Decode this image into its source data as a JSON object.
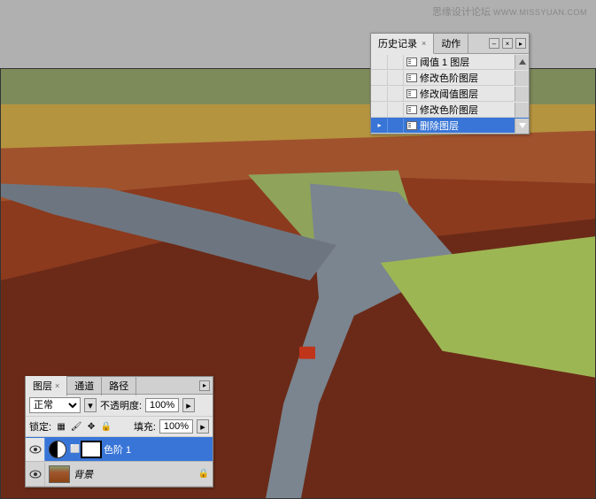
{
  "watermark": {
    "text": "思缘设计论坛",
    "url": "WWW.MISSYUAN.COM"
  },
  "history": {
    "tabs": {
      "active": "历史记录",
      "other": "动作"
    },
    "items": [
      {
        "label": "阈值 1 图层"
      },
      {
        "label": "修改色阶图层"
      },
      {
        "label": "修改阈值图层"
      },
      {
        "label": "修改色阶图层"
      },
      {
        "label": "删除图层",
        "selected": true
      }
    ]
  },
  "layers": {
    "tabs": {
      "active": "图层",
      "t2": "通道",
      "t3": "路径"
    },
    "blend_mode": "正常",
    "opacity_label": "不透明度:",
    "opacity_value": "100%",
    "lock_label": "锁定:",
    "fill_label": "填充:",
    "fill_value": "100%",
    "items": [
      {
        "name": "色阶 1",
        "type": "adjustment",
        "selected": true
      },
      {
        "name": "背景",
        "type": "bg",
        "locked": true
      }
    ]
  }
}
